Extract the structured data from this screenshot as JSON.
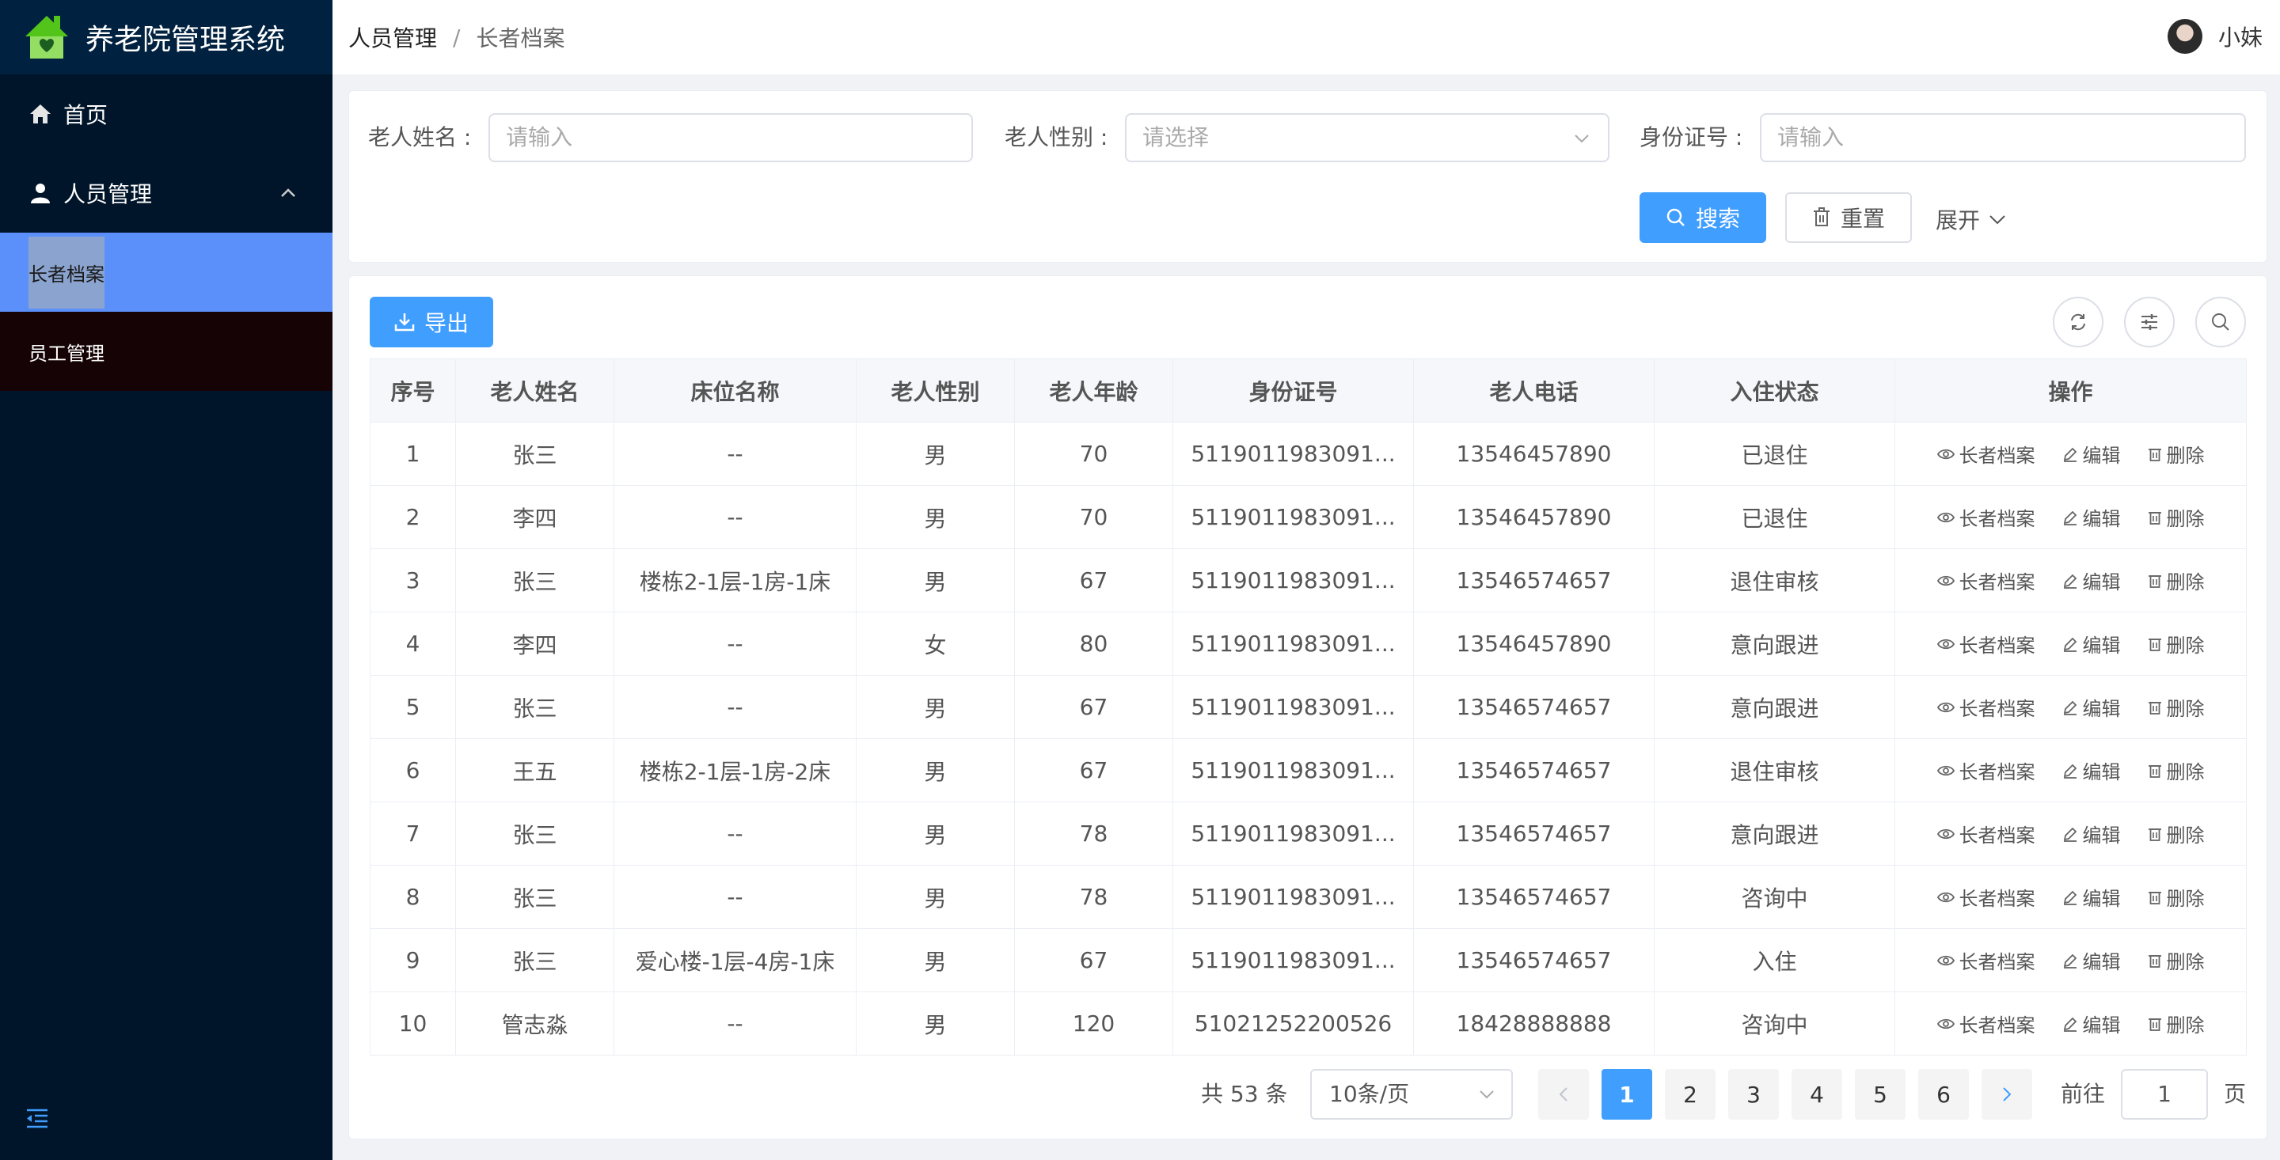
{
  "app": {
    "title": "养老院管理系统"
  },
  "sidebar": {
    "home": "首页",
    "group": "人员管理",
    "sub_items": [
      "长者档案",
      "员工管理"
    ]
  },
  "breadcrumb": {
    "parent": "人员管理",
    "separator": "/",
    "current": "长者档案"
  },
  "user": {
    "name": "小妹"
  },
  "search": {
    "name_label": "老人姓名 :",
    "name_placeholder": "请输入",
    "gender_label": "老人性别 :",
    "gender_placeholder": "请选择",
    "id_label": "身份证号 :",
    "id_placeholder": "请输入",
    "search_btn": "搜索",
    "reset_btn": "重置",
    "expand": "展开"
  },
  "toolbar": {
    "export_btn": "导出"
  },
  "table": {
    "columns": [
      "序号",
      "老人姓名",
      "床位名称",
      "老人性别",
      "老人年龄",
      "身份证号",
      "老人电话",
      "入住状态",
      "操作"
    ],
    "ops": [
      "长者档案",
      "编辑",
      "删除"
    ],
    "rows": [
      [
        "1",
        "张三",
        "--",
        "男",
        "70",
        "5119011983091...",
        "13546457890",
        "已退住"
      ],
      [
        "2",
        "李四",
        "--",
        "男",
        "70",
        "5119011983091...",
        "13546457890",
        "已退住"
      ],
      [
        "3",
        "张三",
        "楼栋2-1层-1房-1床",
        "男",
        "67",
        "5119011983091...",
        "13546574657",
        "退住审核"
      ],
      [
        "4",
        "李四",
        "--",
        "女",
        "80",
        "5119011983091...",
        "13546457890",
        "意向跟进"
      ],
      [
        "5",
        "张三",
        "--",
        "男",
        "67",
        "5119011983091...",
        "13546574657",
        "意向跟进"
      ],
      [
        "6",
        "王五",
        "楼栋2-1层-1房-2床",
        "男",
        "67",
        "5119011983091...",
        "13546574657",
        "退住审核"
      ],
      [
        "7",
        "张三",
        "--",
        "男",
        "78",
        "5119011983091...",
        "13546574657",
        "意向跟进"
      ],
      [
        "8",
        "张三",
        "--",
        "男",
        "78",
        "5119011983091...",
        "13546574657",
        "咨询中"
      ],
      [
        "9",
        "张三",
        "爱心楼-1层-4房-1床",
        "男",
        "67",
        "5119011983091...",
        "13546574657",
        "入住"
      ],
      [
        "10",
        "管志淼",
        "--",
        "男",
        "120",
        "51021252200526",
        "18428888888",
        "咨询中"
      ]
    ]
  },
  "pagination": {
    "total": "共 53 条",
    "page_size": "10条/页",
    "pages": [
      "1",
      "2",
      "3",
      "4",
      "5",
      "6"
    ],
    "goto_label": "前往",
    "goto_value": "1",
    "page_unit": "页"
  },
  "colors": {
    "primary": "#409eff",
    "sidebar_bg": "#001529",
    "active_menu": "#5b8ff9"
  }
}
